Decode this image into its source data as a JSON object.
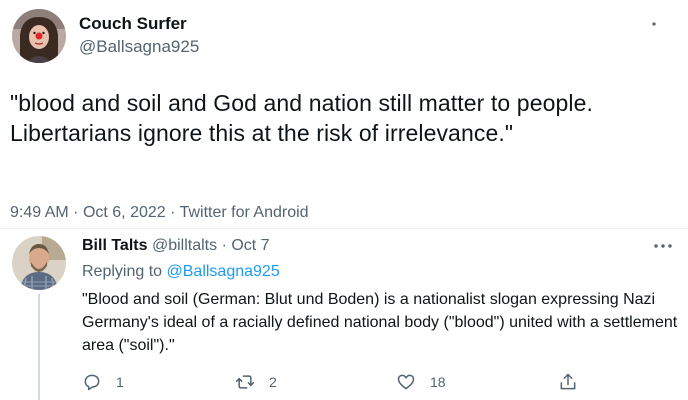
{
  "main_tweet": {
    "author_name": "Couch Surfer",
    "author_handle": "@Ballsagna925",
    "text": "\"blood and soil and God and nation still matter to people. Libertarians ignore this at the risk of irrelevance.\"",
    "time": "9:49 AM",
    "date": "Oct 6, 2022",
    "source": "Twitter for Android",
    "separator": "·"
  },
  "reply": {
    "author_name": "Bill Talts",
    "author_handle": "@billtalts",
    "date": "Oct 7",
    "separator": "·",
    "replying_prefix": "Replying to",
    "replying_to": "@Ballsagna925",
    "text": "\"Blood and soil (German: Blut und Boden) is a nationalist slogan expressing Nazi Germany's ideal of a racially defined national body (\"blood\") united with a settlement area (\"soil\").\"",
    "actions": {
      "reply_count": "1",
      "retweet_count": "2",
      "like_count": "18"
    }
  },
  "icons": {
    "more": "more-options-icon",
    "reply": "reply-icon",
    "retweet": "retweet-icon",
    "like": "heart-icon",
    "share": "share-icon"
  },
  "colors": {
    "text_primary": "#0f1419",
    "text_secondary": "#536471",
    "link": "#1d9bf0",
    "divider": "#eff3f4",
    "thread_line": "#cfd9de"
  }
}
